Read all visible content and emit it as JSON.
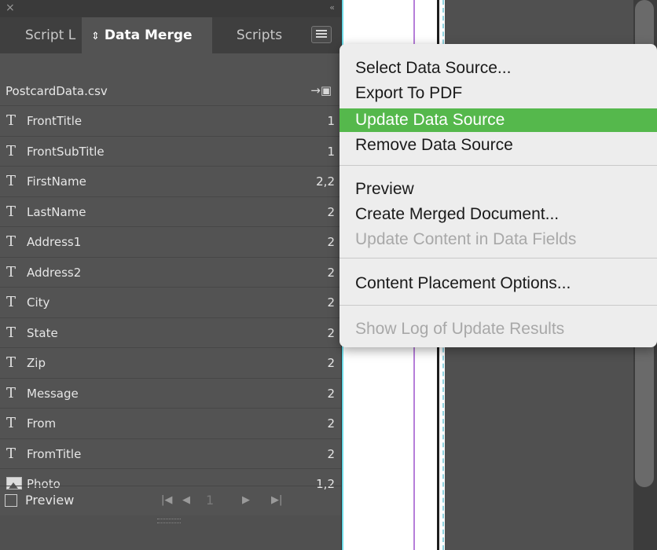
{
  "panel": {
    "close_glyph": "×",
    "collapse_glyph": "‹‹",
    "tabs": [
      {
        "label": "Script L"
      },
      {
        "label": "Data Merge"
      },
      {
        "label": "Scripts"
      }
    ],
    "source_file": "PostcardData.csv",
    "fields": [
      {
        "type": "text",
        "name": "FrontTitle",
        "count": "1"
      },
      {
        "type": "text",
        "name": "FrontSubTitle",
        "count": "1"
      },
      {
        "type": "text",
        "name": "FirstName",
        "count": "2,2"
      },
      {
        "type": "text",
        "name": "LastName",
        "count": "2"
      },
      {
        "type": "text",
        "name": "Address1",
        "count": "2"
      },
      {
        "type": "text",
        "name": "Address2",
        "count": "2"
      },
      {
        "type": "text",
        "name": "City",
        "count": "2"
      },
      {
        "type": "text",
        "name": "State",
        "count": "2"
      },
      {
        "type": "text",
        "name": "Zip",
        "count": "2"
      },
      {
        "type": "text",
        "name": "Message",
        "count": "2"
      },
      {
        "type": "text",
        "name": "From",
        "count": "2"
      },
      {
        "type": "text",
        "name": "FromTitle",
        "count": "2"
      },
      {
        "type": "image",
        "name": "Photo",
        "count": "1,2"
      }
    ],
    "text_field_glyph": "T",
    "footer": {
      "preview_label": "Preview",
      "preview_checked": false,
      "page_number": "1"
    }
  },
  "menu": {
    "items": [
      {
        "label": "Select Data Source...",
        "state": "normal"
      },
      {
        "label": "Export To PDF",
        "state": "normal"
      },
      {
        "label": "Update Data Source",
        "state": "highlighted"
      },
      {
        "label": "Remove Data Source",
        "state": "normal"
      },
      {
        "label": "Preview",
        "state": "normal"
      },
      {
        "label": "Create Merged Document...",
        "state": "normal"
      },
      {
        "label": "Update Content in Data Fields",
        "state": "disabled"
      },
      {
        "label": "Content Placement Options...",
        "state": "normal"
      },
      {
        "label": "Show Log of Update Results",
        "state": "disabled"
      }
    ]
  },
  "colors": {
    "highlight": "#55b84c",
    "panel_bg": "#535353",
    "menu_bg": "#ededed"
  }
}
